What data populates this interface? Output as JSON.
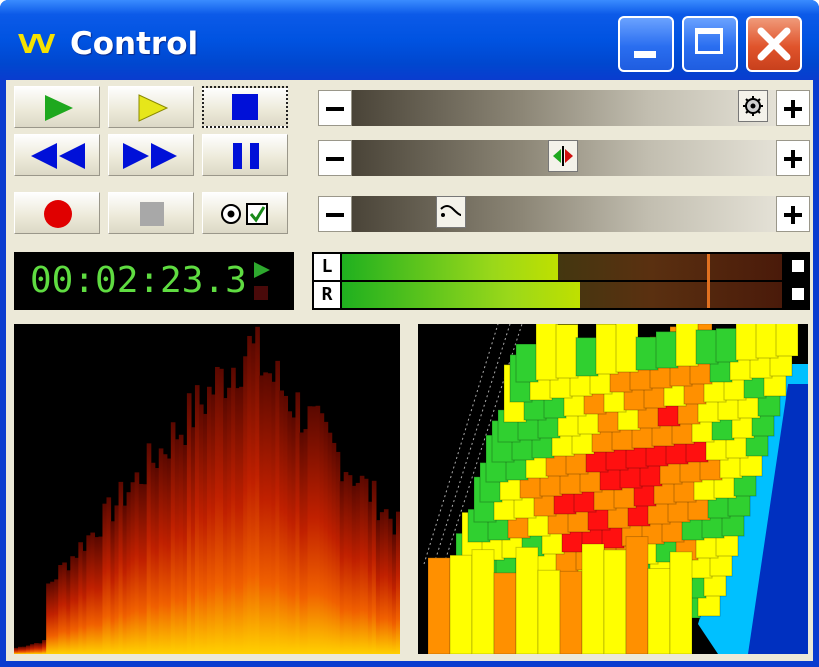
{
  "window": {
    "title": "Control",
    "app_icon_text": "VV",
    "title_buttons": [
      "minimize-icon",
      "maximize-icon",
      "close-icon"
    ]
  },
  "transport": {
    "buttons": [
      {
        "name": "play",
        "icon": "play-icon",
        "color": "#1ea81e"
      },
      {
        "name": "play-alt",
        "icon": "play-icon",
        "color": "#e6e61a"
      },
      {
        "name": "stop",
        "icon": "stop-icon",
        "color": "#0010d8",
        "selected": true
      },
      {
        "name": "rewind",
        "icon": "rewind-icon",
        "color": "#0010d8"
      },
      {
        "name": "fast-forward",
        "icon": "fast-forward-icon",
        "color": "#0010d8"
      },
      {
        "name": "pause",
        "icon": "pause-icon",
        "color": "#0010d8"
      },
      {
        "name": "record",
        "icon": "record-icon",
        "color": "#e00000"
      },
      {
        "name": "square",
        "icon": "square-icon",
        "color": "#a8a8a8"
      },
      {
        "name": "options",
        "icon": "radio-checkbox-icon",
        "color": "#000000"
      }
    ]
  },
  "sliders": [
    {
      "name": "settings-slider",
      "thumb_icon": "gear-icon",
      "level": 0.99
    },
    {
      "name": "balance-slider",
      "thumb_icon": "balance-icon",
      "level": 0.49
    },
    {
      "name": "tempo-slider",
      "thumb_icon": "curve-icon",
      "level": 0.21
    }
  ],
  "time": {
    "display": "00:02:23.3",
    "status_icons": [
      "play-indicator-icon",
      "record-indicator-icon"
    ]
  },
  "level_meter": {
    "left_label": "L",
    "right_label": "R",
    "left_level": 0.49,
    "right_level": 0.54,
    "peak_level": 0.83,
    "colors": [
      "#1fb01f",
      "#bfe000",
      "#8a3a10"
    ]
  },
  "visualizers": [
    {
      "name": "spectrogram",
      "palette": [
        "#000000",
        "#7a0a00",
        "#e04000",
        "#ffd000"
      ]
    },
    {
      "name": "3d-spectrum",
      "palette": [
        "#0030c0",
        "#00c0ff",
        "#30d030",
        "#ffff00",
        "#ff9000",
        "#ff1010"
      ]
    }
  ]
}
